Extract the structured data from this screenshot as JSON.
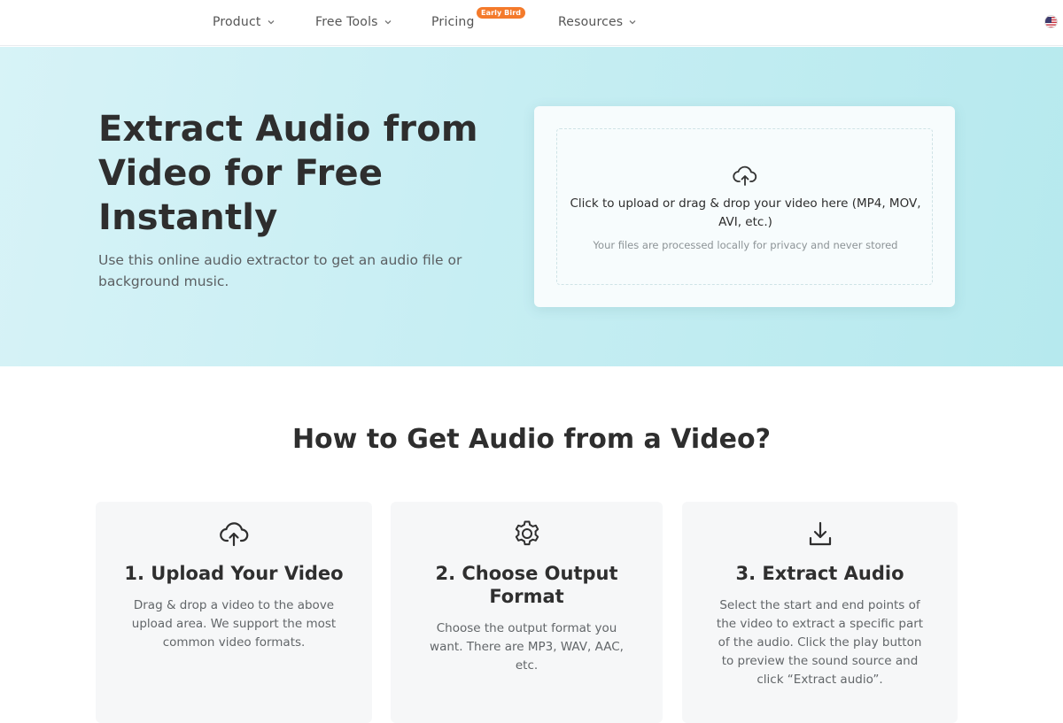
{
  "nav": {
    "items": [
      {
        "label": "Product",
        "has_dropdown": true
      },
      {
        "label": "Free Tools",
        "has_dropdown": true
      },
      {
        "label": "Pricing",
        "has_dropdown": false
      },
      {
        "label": "Resources",
        "has_dropdown": true
      }
    ],
    "pricing_badge": "Early Bird",
    "language_icon": "us-flag-icon"
  },
  "hero": {
    "title": "Extract Audio from Video for Free Instantly",
    "subtitle": "Use this online audio extractor to get an audio file or background music.",
    "upload": {
      "icon": "cloud-upload-icon",
      "prompt": "Click to upload or drag & drop your video here (MP4, MOV, AVI, etc.)",
      "note": "Your files are processed locally for privacy and never stored"
    }
  },
  "how_to": {
    "title": "How to Get Audio from a Video?",
    "steps": [
      {
        "icon": "cloud-upload-icon",
        "title": "1. Upload Your Video",
        "description": "Drag & drop a video to the above upload area. We support the most common video formats."
      },
      {
        "icon": "gear-icon",
        "title": "2. Choose Output Format",
        "description": "Choose the output format you want. There are MP3, WAV, AAC, etc."
      },
      {
        "icon": "download-icon",
        "title": "3. Extract Audio",
        "description": "Select the start and end points of the video to extract a specific part of the audio. Click the play button to preview the sound source and click “Extract audio”."
      }
    ]
  },
  "colors": {
    "accent_badge": "#f47a2b",
    "hero_background": "#c7eef3",
    "text_dark": "#2e2e2e"
  }
}
